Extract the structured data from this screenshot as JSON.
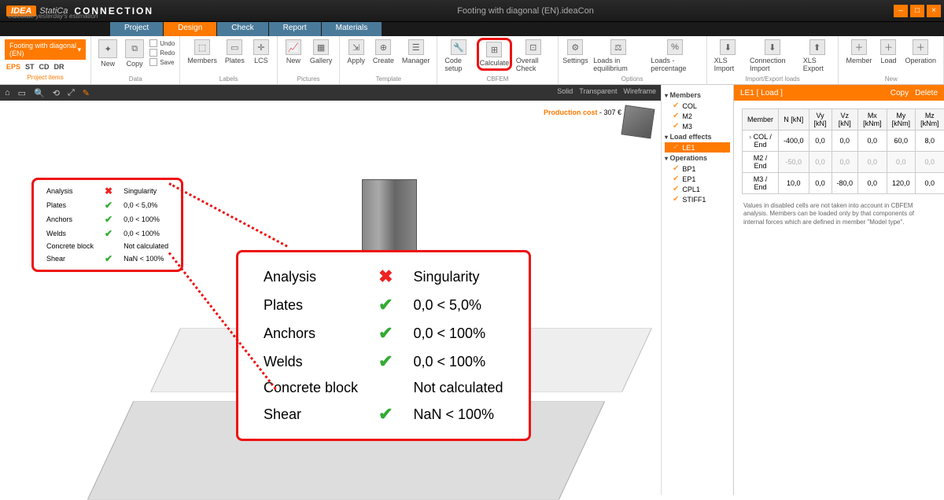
{
  "title_doc": "Footing with diagonal (EN).ideaCon",
  "brand": {
    "logo": "IDEA",
    "sub": "StatiCa",
    "conn": "CONNECTION",
    "tag": "Calculate yesterday's estimation"
  },
  "tabs": [
    "Project",
    "Design",
    "Check",
    "Report",
    "Materials"
  ],
  "active_tab": 1,
  "project_item": {
    "name": "Footing with diagonal (EN)",
    "subs": [
      "EPS",
      "ST",
      "CD",
      "DR"
    ],
    "group": "Project items"
  },
  "ribbon": {
    "data": {
      "new": "New",
      "copy": "Copy",
      "undo": "Undo",
      "redo": "Redo",
      "save": "Save",
      "label": "Data"
    },
    "labels": {
      "members": "Members",
      "plates": "Plates",
      "lcs": "LCS",
      "label": "Labels"
    },
    "pictures": {
      "new": "New",
      "gallery": "Gallery",
      "label": "Pictures"
    },
    "template": {
      "apply": "Apply",
      "create": "Create",
      "manager": "Manager",
      "label": "Template"
    },
    "cbfem": {
      "code": "Code setup",
      "calc": "Calculate",
      "overall": "Overall Check",
      "label": "CBFEM"
    },
    "options": {
      "settings": "Settings",
      "loadeq": "Loads in equilibrium",
      "loadpct": "Loads - percentage",
      "label": "Options"
    },
    "ie": {
      "xlsimp": "XLS Import",
      "connimp": "Connection Import",
      "xlsexp": "XLS Export",
      "label": "Import/Export loads"
    },
    "new": {
      "member": "Member",
      "load": "Load",
      "op": "Operation",
      "label": "New"
    }
  },
  "viewmodes": [
    "Solid",
    "Transparent",
    "Wireframe"
  ],
  "prod_cost": {
    "label": "Production cost",
    "value": "307 €"
  },
  "results": [
    {
      "name": "Analysis",
      "status": "fail",
      "value": "Singularity"
    },
    {
      "name": "Plates",
      "status": "ok",
      "value": "0,0 < 5,0%"
    },
    {
      "name": "Anchors",
      "status": "ok",
      "value": "0,0 < 100%"
    },
    {
      "name": "Welds",
      "status": "ok",
      "value": "0,0 < 100%"
    },
    {
      "name": "Concrete block",
      "status": "",
      "value": "Not calculated"
    },
    {
      "name": "Shear",
      "status": "ok",
      "value": "NaN < 100%"
    }
  ],
  "tree": {
    "members_h": "Members",
    "members": [
      "COL",
      "M2",
      "M3"
    ],
    "loads_h": "Load effects",
    "loads": [
      "LE1"
    ],
    "ops_h": "Operations",
    "ops": [
      "BP1",
      "EP1",
      "CPL1",
      "STIFF1"
    ]
  },
  "rpanel": {
    "title": "LE1 [ Load ]",
    "copy": "Copy",
    "delete": "Delete",
    "cols": [
      "Member",
      "N [kN]",
      "Vy [kN]",
      "Vz [kN]",
      "Mx [kNm]",
      "My [kNm]",
      "Mz [kNm]"
    ],
    "rows": [
      {
        "m": "COL / End",
        "n": "-400,0",
        "vy": "0,0",
        "vz": "0,0",
        "mx": "0,0",
        "my": "60,0",
        "mz": "8,0",
        "sel": true
      },
      {
        "m": "M2 / End",
        "n": "-50,0",
        "vy": "0,0",
        "vz": "0,0",
        "mx": "0,0",
        "my": "0,0",
        "mz": "0,0",
        "dis": true
      },
      {
        "m": "M3 / End",
        "n": "10,0",
        "vy": "0,0",
        "vz": "-80,0",
        "mx": "0,0",
        "my": "120,0",
        "mz": "0,0"
      }
    ],
    "note": "Values in disabled cells are not taken into account in CBFEM analysis. Members can be loaded only by that components of internal forces which are defined in member \"Model type\"."
  }
}
